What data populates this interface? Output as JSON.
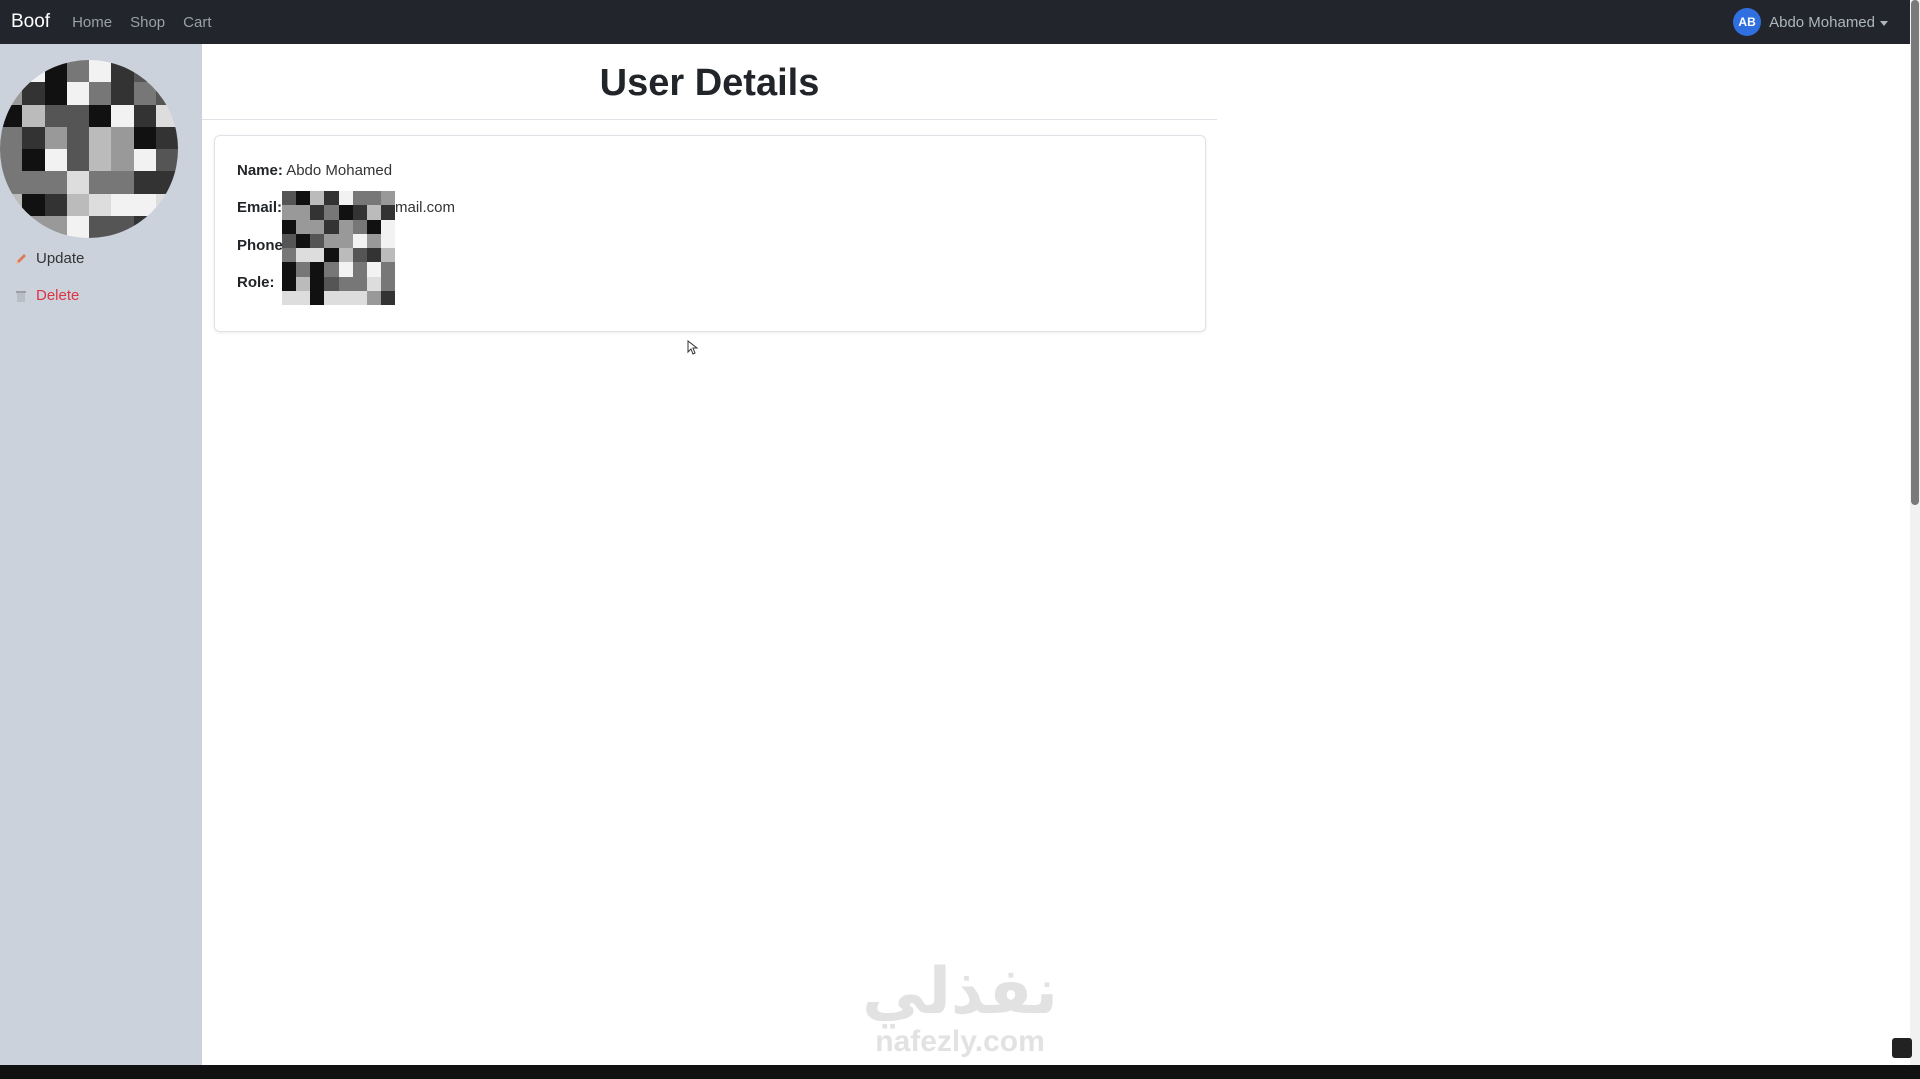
{
  "navbar": {
    "brand": "Boof",
    "links": [
      "Home",
      "Shop",
      "Cart"
    ],
    "user": {
      "initials": "AB",
      "name": "Abdo Mohamed"
    }
  },
  "sidebar": {
    "actions": {
      "update": "Update",
      "delete": "Delete"
    }
  },
  "main": {
    "title": "User Details",
    "details": {
      "name_label": "Name:",
      "name_value": "Abdo Mohamed",
      "email_label": "Email:",
      "email_suffix": "mail.com",
      "phone_label": "Phone",
      "role_label": "Role:"
    }
  },
  "watermark": {
    "arabic": "نفذلي",
    "latin": "nafezly.com"
  },
  "colors": {
    "navbar_bg": "#22262c",
    "sidebar_bg": "#ccd2db",
    "avatar_badge": "#2f6fe0",
    "delete_red": "#dc3545"
  }
}
